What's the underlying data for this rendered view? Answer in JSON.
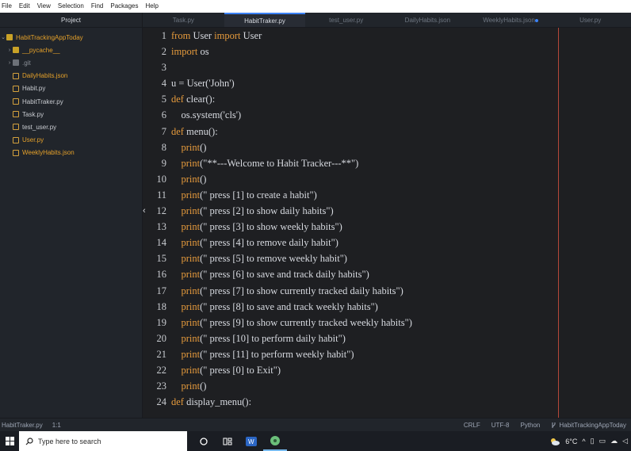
{
  "menu": [
    "File",
    "Edit",
    "View",
    "Selection",
    "Find",
    "Packages",
    "Help"
  ],
  "sidebar": {
    "title": "Project",
    "root": "HabitTrackingAppToday",
    "items": [
      {
        "label": "__pycache__",
        "type": "folder"
      },
      {
        "label": ".git",
        "type": "folder-grey"
      },
      {
        "label": "DailyHabits.json",
        "type": "file-modified"
      },
      {
        "label": "Habit.py",
        "type": "file"
      },
      {
        "label": "HabitTraker.py",
        "type": "file"
      },
      {
        "label": "Task.py",
        "type": "file"
      },
      {
        "label": "test_user.py",
        "type": "file"
      },
      {
        "label": "User.py",
        "type": "file-modified"
      },
      {
        "label": "WeeklyHabits.json",
        "type": "file-modified"
      }
    ]
  },
  "tabs": [
    {
      "label": "Task.py",
      "active": false
    },
    {
      "label": "HabitTraker.py",
      "active": true
    },
    {
      "label": "test_user.py",
      "active": false
    },
    {
      "label": "DailyHabits.json",
      "active": false
    },
    {
      "label": "WeeklyHabits.json",
      "active": false,
      "modified": true
    },
    {
      "label": "User.py",
      "active": false
    }
  ],
  "editor": {
    "line_numbers": [
      "1",
      "2",
      "3",
      "4",
      "5",
      "6",
      "7",
      "8",
      "9",
      "10",
      "11",
      "12",
      "13",
      "14",
      "15",
      "16",
      "17",
      "18",
      "19",
      "20",
      "21",
      "22",
      "23",
      "24"
    ],
    "lines": [
      "from User import User",
      "import os",
      "",
      "u = User('John')",
      "def clear():",
      "    os.system('cls')",
      "def menu():",
      "    print()",
      "    print(\"**---Welcome to Habit Tracker---**\")",
      "    print()",
      "    print(\" press [1] to create a habit\")",
      "    print(\" press [2] to show daily habits\")",
      "    print(\" press [3] to show weekly habits\")",
      "    print(\" press [4] to remove daily habit\")",
      "    print(\" press [5] to remove weekly habit\")",
      "    print(\" press [6] to save and track daily habits\")",
      "    print(\" press [7] to show currently tracked daily habits\")",
      "    print(\" press [8] to save and track weekly habits\")",
      "    print(\" press [9] to show currently tracked weekly habits\")",
      "    print(\" press [10] to perform daily habit\")",
      "    print(\" press [11] to perform weekly habit\")",
      "    print(\" press [0] to Exit\")",
      "    print()",
      "def display_menu():"
    ]
  },
  "status": {
    "file": "HabitTraker.py",
    "cursor": "1:1",
    "line_ending": "CRLF",
    "encoding": "UTF-8",
    "grammar": "Python",
    "project": "HabitTrackingAppToday"
  },
  "taskbar": {
    "search_placeholder": "Type here to search",
    "temperature": "6°C"
  },
  "colors": {
    "keyword": "#e59a3c",
    "text": "#d7dae0",
    "background": "#1e1f22",
    "accent": "#3b82f6",
    "wrap_guide": "#b5473a"
  }
}
